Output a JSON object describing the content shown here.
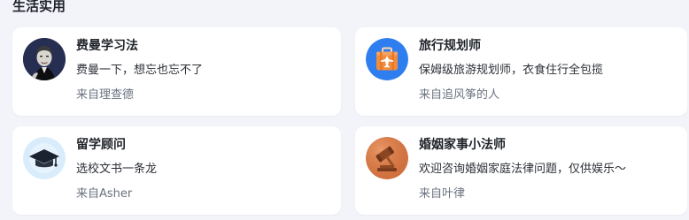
{
  "section": {
    "title": "生活实用"
  },
  "cards": [
    {
      "name": "费曼学习法",
      "desc": "费曼一下，想忘也忘不了",
      "author_prefix": "来自",
      "author": "理查德",
      "icon": "portrait-avatar-icon"
    },
    {
      "name": "旅行规划师",
      "desc": "保姆级旅游规划师，衣食住行全包揽",
      "author_prefix": "来自",
      "author": "追风筝的人",
      "icon": "suitcase-plane-icon"
    },
    {
      "name": "留学顾问",
      "desc": "选校文书一条龙",
      "author_prefix": "来自",
      "author": "Asher",
      "icon": "graduation-cap-icon"
    },
    {
      "name": "婚姻家事小法师",
      "desc": "欢迎咨询婚姻家庭法律问题，仅供娱乐～",
      "author_prefix": "来自",
      "author": "叶律",
      "icon": "gavel-icon"
    }
  ],
  "colors": {
    "background": "#f3f4f9",
    "card": "#ffffff",
    "travel_icon_bg": "#2f7ef0",
    "travel_suitcase": "#f28c3c",
    "study_icon_bg": "#d8ecfb",
    "law_icon_bg": "#d97a45"
  }
}
